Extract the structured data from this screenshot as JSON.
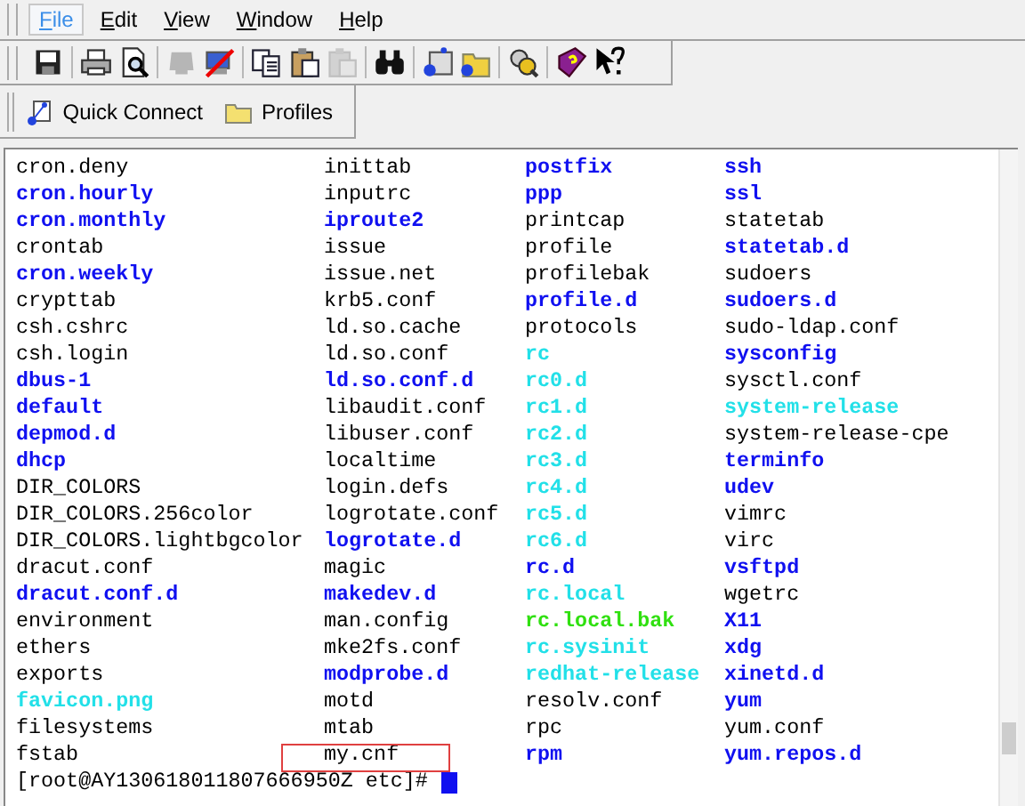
{
  "menu": [
    {
      "label": "File",
      "selected": true
    },
    {
      "label": "Edit",
      "selected": false
    },
    {
      "label": "View",
      "selected": false
    },
    {
      "label": "Window",
      "selected": false
    },
    {
      "label": "Help",
      "selected": false
    }
  ],
  "toolbar": {
    "groups": [
      [
        {
          "disabled": false
        }
      ],
      [
        {
          "disabled": false
        },
        {
          "disabled": false
        }
      ],
      [
        {
          "disabled": true
        },
        {
          "disabled": false
        }
      ],
      [
        {
          "disabled": false
        },
        {
          "disabled": false
        },
        {
          "disabled": true
        }
      ],
      [
        {
          "disabled": false
        }
      ],
      [
        {
          "disabled": false
        },
        {
          "disabled": false
        }
      ],
      [
        {
          "disabled": false
        }
      ],
      [
        {
          "disabled": false
        },
        {
          "disabled": false
        }
      ]
    ]
  },
  "quickbar": {
    "buttons": [
      {
        "label": "Quick Connect"
      },
      {
        "label": "Profiles"
      }
    ]
  },
  "terminal": {
    "columns": [
      [
        {
          "name": "cron.deny",
          "kind": "file"
        },
        {
          "name": "cron.hourly",
          "kind": "dir"
        },
        {
          "name": "cron.monthly",
          "kind": "dir"
        },
        {
          "name": "crontab",
          "kind": "file"
        },
        {
          "name": "cron.weekly",
          "kind": "dir"
        },
        {
          "name": "crypttab",
          "kind": "file"
        },
        {
          "name": "csh.cshrc",
          "kind": "file"
        },
        {
          "name": "csh.login",
          "kind": "file"
        },
        {
          "name": "dbus-1",
          "kind": "dir"
        },
        {
          "name": "default",
          "kind": "dir"
        },
        {
          "name": "depmod.d",
          "kind": "dir"
        },
        {
          "name": "dhcp",
          "kind": "dir"
        },
        {
          "name": "DIR_COLORS",
          "kind": "file"
        },
        {
          "name": "DIR_COLORS.256color",
          "kind": "file"
        },
        {
          "name": "DIR_COLORS.lightbgcolor",
          "kind": "file"
        },
        {
          "name": "dracut.conf",
          "kind": "file"
        },
        {
          "name": "dracut.conf.d",
          "kind": "dir"
        },
        {
          "name": "environment",
          "kind": "file"
        },
        {
          "name": "ethers",
          "kind": "file"
        },
        {
          "name": "exports",
          "kind": "file"
        },
        {
          "name": "favicon.png",
          "kind": "link"
        },
        {
          "name": "filesystems",
          "kind": "file"
        },
        {
          "name": "fstab",
          "kind": "file"
        }
      ],
      [
        {
          "name": "inittab",
          "kind": "file"
        },
        {
          "name": "inputrc",
          "kind": "file"
        },
        {
          "name": "iproute2",
          "kind": "dir"
        },
        {
          "name": "issue",
          "kind": "file"
        },
        {
          "name": "issue.net",
          "kind": "file"
        },
        {
          "name": "krb5.conf",
          "kind": "file"
        },
        {
          "name": "ld.so.cache",
          "kind": "file"
        },
        {
          "name": "ld.so.conf",
          "kind": "file"
        },
        {
          "name": "ld.so.conf.d",
          "kind": "dir"
        },
        {
          "name": "libaudit.conf",
          "kind": "file"
        },
        {
          "name": "libuser.conf",
          "kind": "file"
        },
        {
          "name": "localtime",
          "kind": "file"
        },
        {
          "name": "login.defs",
          "kind": "file"
        },
        {
          "name": "logrotate.conf",
          "kind": "file"
        },
        {
          "name": "logrotate.d",
          "kind": "dir"
        },
        {
          "name": "magic",
          "kind": "file"
        },
        {
          "name": "makedev.d",
          "kind": "dir"
        },
        {
          "name": "man.config",
          "kind": "file"
        },
        {
          "name": "mke2fs.conf",
          "kind": "file"
        },
        {
          "name": "modprobe.d",
          "kind": "dir"
        },
        {
          "name": "motd",
          "kind": "file"
        },
        {
          "name": "mtab",
          "kind": "file"
        },
        {
          "name": "my.cnf",
          "kind": "file"
        }
      ],
      [
        {
          "name": "postfix",
          "kind": "dir"
        },
        {
          "name": "ppp",
          "kind": "dir"
        },
        {
          "name": "printcap",
          "kind": "file"
        },
        {
          "name": "profile",
          "kind": "file"
        },
        {
          "name": "profilebak",
          "kind": "file"
        },
        {
          "name": "profile.d",
          "kind": "dir"
        },
        {
          "name": "protocols",
          "kind": "file"
        },
        {
          "name": "rc",
          "kind": "link"
        },
        {
          "name": "rc0.d",
          "kind": "link"
        },
        {
          "name": "rc1.d",
          "kind": "link"
        },
        {
          "name": "rc2.d",
          "kind": "link"
        },
        {
          "name": "rc3.d",
          "kind": "link"
        },
        {
          "name": "rc4.d",
          "kind": "link"
        },
        {
          "name": "rc5.d",
          "kind": "link"
        },
        {
          "name": "rc6.d",
          "kind": "link"
        },
        {
          "name": "rc.d",
          "kind": "dir"
        },
        {
          "name": "rc.local",
          "kind": "link"
        },
        {
          "name": "rc.local.bak",
          "kind": "exec"
        },
        {
          "name": "rc.sysinit",
          "kind": "link"
        },
        {
          "name": "redhat-release",
          "kind": "link"
        },
        {
          "name": "resolv.conf",
          "kind": "file"
        },
        {
          "name": "rpc",
          "kind": "file"
        },
        {
          "name": "rpm",
          "kind": "dir"
        }
      ],
      [
        {
          "name": "ssh",
          "kind": "dir"
        },
        {
          "name": "ssl",
          "kind": "dir"
        },
        {
          "name": "statetab",
          "kind": "file"
        },
        {
          "name": "statetab.d",
          "kind": "dir"
        },
        {
          "name": "sudoers",
          "kind": "file"
        },
        {
          "name": "sudoers.d",
          "kind": "dir"
        },
        {
          "name": "sudo-ldap.conf",
          "kind": "file"
        },
        {
          "name": "sysconfig",
          "kind": "dir"
        },
        {
          "name": "sysctl.conf",
          "kind": "file"
        },
        {
          "name": "system-release",
          "kind": "link"
        },
        {
          "name": "system-release-cpe",
          "kind": "file"
        },
        {
          "name": "terminfo",
          "kind": "dir"
        },
        {
          "name": "udev",
          "kind": "dir"
        },
        {
          "name": "vimrc",
          "kind": "file"
        },
        {
          "name": "virc",
          "kind": "file"
        },
        {
          "name": "vsftpd",
          "kind": "dir"
        },
        {
          "name": "wgetrc",
          "kind": "file"
        },
        {
          "name": "X11",
          "kind": "dir"
        },
        {
          "name": "xdg",
          "kind": "dir"
        },
        {
          "name": "xinetd.d",
          "kind": "dir"
        },
        {
          "name": "yum",
          "kind": "dir"
        },
        {
          "name": "yum.conf",
          "kind": "file"
        },
        {
          "name": "yum.repos.d",
          "kind": "dir"
        }
      ]
    ],
    "prompt": "[root@AY130618011807666950Z etc]#"
  }
}
